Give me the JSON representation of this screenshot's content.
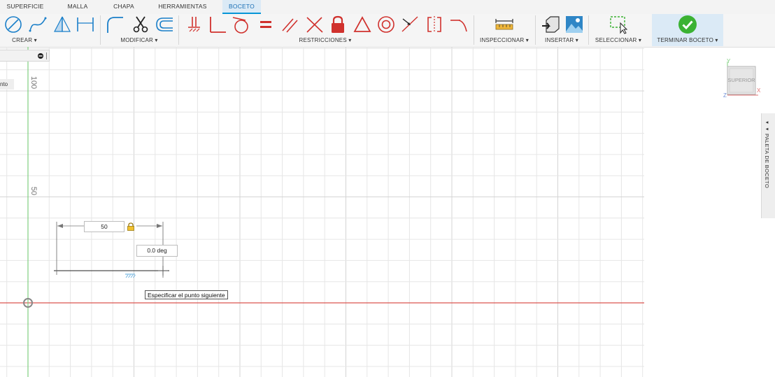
{
  "tabs": [
    {
      "label": "SUPERFICIE",
      "active": false
    },
    {
      "label": "MALLA",
      "active": false
    },
    {
      "label": "CHAPA",
      "active": false
    },
    {
      "label": "HERRAMIENTAS",
      "active": false
    },
    {
      "label": "BOCETO",
      "active": true
    }
  ],
  "toolbar": {
    "groups": {
      "crear": "CREAR ▾",
      "modificar": "MODIFICAR ▾",
      "restricciones": "RESTRICCIONES ▾",
      "inspeccionar": "INSPECCIONAR ▾",
      "insertar": "INSERTAR ▾",
      "seleccionar": "SELECCIONAR ▾",
      "terminar": "TERMINAR BOCETO ▾"
    },
    "icons": {
      "crear": [
        "line-icon",
        "spline-icon",
        "triangle-icon",
        "dimension-icon"
      ],
      "modificar": [
        "fillet-icon",
        "scissors-icon",
        "offset-icon"
      ],
      "restricciones": [
        "fix-icon",
        "perpendicular-icon",
        "tangent-icon",
        "equal-icon",
        "parallel-icon",
        "intersect-icon",
        "lock-icon",
        "triangle-constraint-icon",
        "concentric-icon",
        "midpoint-icon",
        "symmetry-icon",
        "curvature-icon"
      ],
      "inspeccionar": [
        "measure-icon"
      ],
      "insertar": [
        "insert-icon",
        "image-icon"
      ],
      "seleccionar": [
        "select-window-icon"
      ],
      "terminar": [
        "finish-check-icon"
      ]
    },
    "colors": {
      "accent": "#0696d7",
      "constraint": "#d0312d",
      "finish": "#3bb233"
    }
  },
  "browser": {
    "item_text": "nto"
  },
  "canvas": {
    "axis_labels": [
      "100",
      "50"
    ],
    "dimension_length": "50",
    "dimension_angle": "0.0 deg",
    "tooltip": "Especificar el punto siguiente",
    "colors": {
      "grid": "#e6e6e6",
      "x_axis": "#d9534f",
      "y_axis": "#7fcf7f",
      "sketch": "#222222"
    }
  },
  "viewcube": {
    "face": "SUPERIOR",
    "axis_y": "Y",
    "axis_x": "X",
    "axis_z": "Z"
  },
  "palette": {
    "label": "◂◂ PALETA DE BOCETO"
  }
}
